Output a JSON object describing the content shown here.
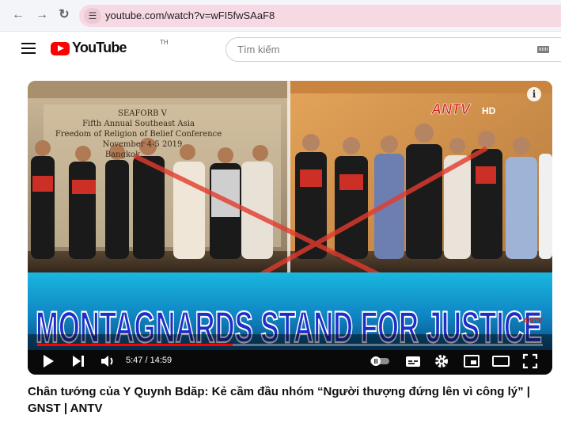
{
  "browser": {
    "url": "youtube.com/watch?v=wFI5fwSAaF8",
    "icons": [
      "back-arrow-icon",
      "forward-arrow-icon",
      "reload-icon",
      "site-settings-icon"
    ]
  },
  "header": {
    "logo_text": "YouTube",
    "logo_sup": "TH",
    "search_placeholder": "Tìm kiếm",
    "icons": [
      "menu-icon",
      "keyboard-icon"
    ]
  },
  "player": {
    "time": "5:47 / 14:59",
    "progress": 0.386,
    "banner_text": "MONTAGNARDS STAND FOR JUSTICE",
    "channel_bug": "ANTV",
    "channel_bug_suffix": "HD",
    "small_bug": "ANTV",
    "backdrop_lines": [
      "SEAFORB V",
      "Fifth Annual Southeast Asia",
      "Freedom of Religion of Belief Conference",
      "November 4-5 2019",
      "Bangkok"
    ],
    "accent_color": "#ff0000",
    "banner_color": "#1e2ec8",
    "icons": [
      "info-icon",
      "play-icon",
      "next-icon",
      "volume-icon",
      "autoplay-toggle-icon",
      "subtitles-icon",
      "settings-icon",
      "miniplayer-icon",
      "theater-icon",
      "fullscreen-icon"
    ]
  },
  "video": {
    "title": "Chân tướng của Y Quynh Bdăp: Kẻ cầm đầu nhóm “Người thượng đứng lên vì công lý” | GNST | ANTV"
  }
}
